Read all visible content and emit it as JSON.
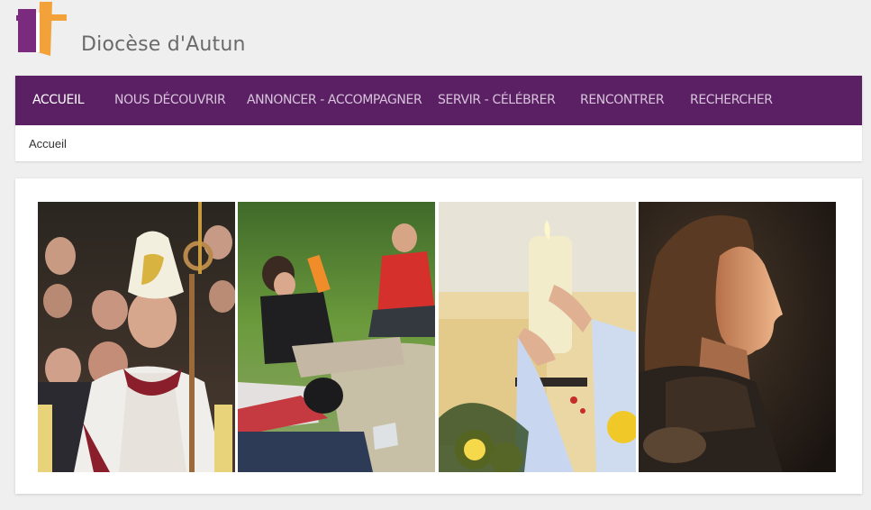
{
  "header": {
    "site_name": "Diocèse d'Autun",
    "logo_icon": "cross-logo-icon",
    "colors": {
      "logo_purple": "#7a2b7d",
      "logo_orange": "#f3a23a"
    }
  },
  "nav": {
    "background": "#5b1f64",
    "items": [
      {
        "label": "Accueil",
        "active": true
      },
      {
        "label": "Nous découvrir",
        "active": false
      },
      {
        "label": "Annoncer - Accompagner",
        "active": false
      },
      {
        "label": "Servir - Célébrer",
        "active": false
      },
      {
        "label": "Rencontrer",
        "active": false
      },
      {
        "label": "Rechercher",
        "active": false
      }
    ]
  },
  "breadcrumb": {
    "current": "Accueil"
  },
  "gallery": {
    "images": [
      {
        "name": "photo-bishop-procession",
        "subject": "bishop with mitre and crozier among crowd"
      },
      {
        "name": "photo-youth-outdoors",
        "subject": "young people sitting on grass"
      },
      {
        "name": "photo-paschal-candle",
        "subject": "hands holding a candle with yellow roses"
      },
      {
        "name": "photo-woman-profile",
        "subject": "woman in profile in warm light"
      }
    ]
  }
}
